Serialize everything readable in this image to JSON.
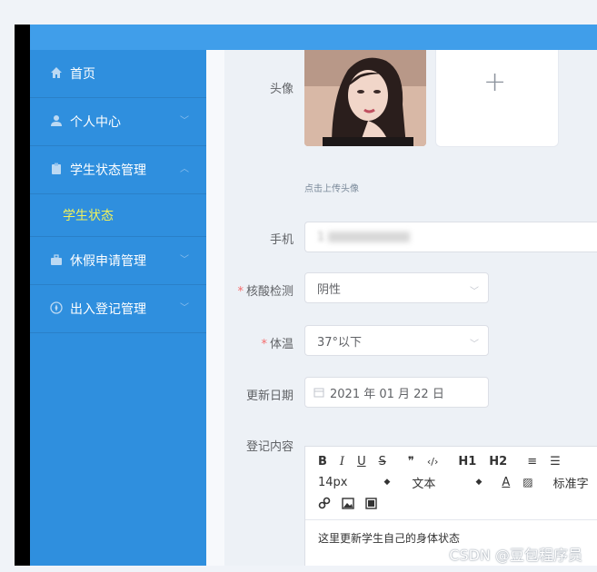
{
  "sidebar": {
    "items": [
      {
        "label": "首页",
        "icon": "home-icon",
        "has_chevron": false
      },
      {
        "label": "个人中心",
        "icon": "user-icon",
        "has_chevron": true
      },
      {
        "label": "学生状态管理",
        "icon": "clipboard-icon",
        "has_chevron": true,
        "expanded": true
      },
      {
        "label": "休假申请管理",
        "icon": "briefcase-icon",
        "has_chevron": true
      },
      {
        "label": "出入登记管理",
        "icon": "compass-icon",
        "has_chevron": true
      }
    ],
    "submenu": {
      "label": "学生状态",
      "active": true
    }
  },
  "form": {
    "avatar_label": "头像",
    "upload_hint": "点击上传头像",
    "upload_plus": "+",
    "phone_label": "手机",
    "phone_value": "1",
    "nucleic_label": "核酸检测",
    "nucleic_value": "阴性",
    "temp_label": "体温",
    "temp_value": "37°以下",
    "date_label": "更新日期",
    "date_value": "2021 年 01 月 22 日",
    "content_label": "登记内容",
    "required_mark": "*"
  },
  "editor": {
    "toolbar_row1": [
      "B",
      "I",
      "U",
      "S",
      "❞",
      "‹/›",
      "H1",
      "H2",
      "≡",
      "☰"
    ],
    "font_size": "14px",
    "font_family": "文本",
    "text_color_btn": "A",
    "standard_label": "标准字",
    "content": "这里更新学生自己的身体状态"
  },
  "watermark": "CSDN @豆包程序员",
  "colors": {
    "sidebar_bg": "#2f8fde",
    "topbar_bg": "#409eea",
    "submenu_active": "#f2f25a",
    "required": "#f56c6c"
  }
}
